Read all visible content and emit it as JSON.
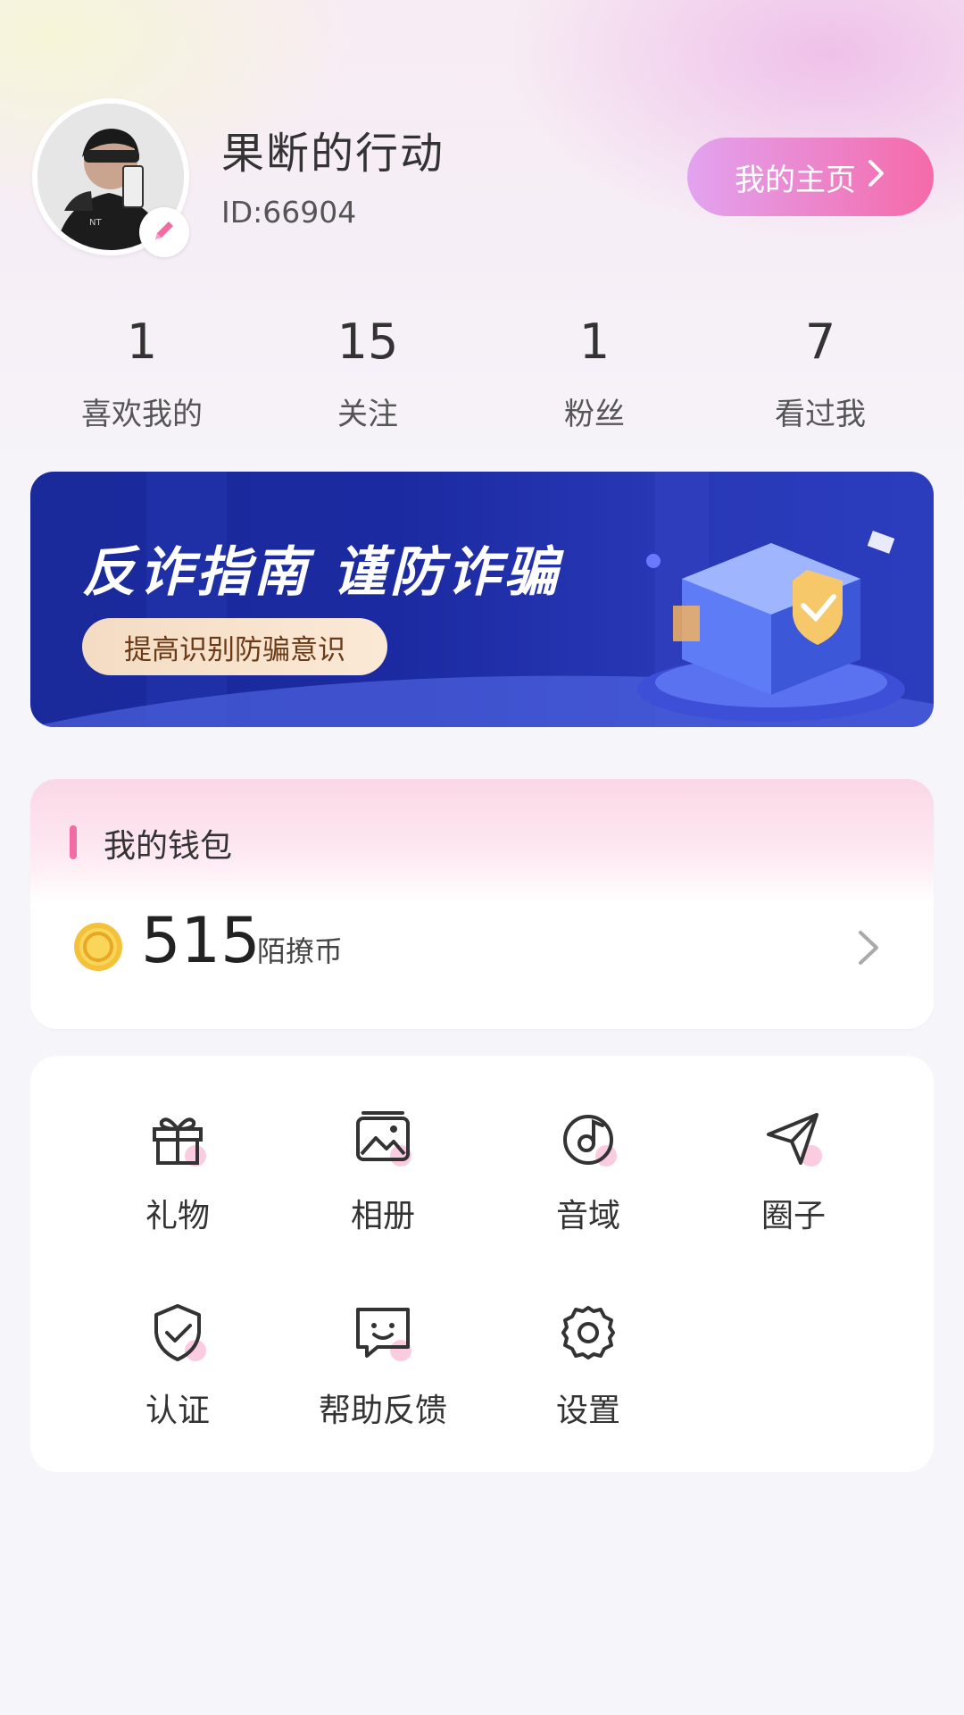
{
  "profile": {
    "username": "果断的行动",
    "user_id": "ID:66904",
    "home_button": "我的主页"
  },
  "stats": [
    {
      "value": "1",
      "label": "喜欢我的"
    },
    {
      "value": "15",
      "label": "关注"
    },
    {
      "value": "1",
      "label": "粉丝"
    },
    {
      "value": "7",
      "label": "看过我"
    }
  ],
  "banner": {
    "title": "反诈指南 谨防诈骗",
    "pill": "提高识别防骗意识"
  },
  "wallet": {
    "title": "我的钱包",
    "amount": "515",
    "unit": "陌撩币"
  },
  "menu": [
    {
      "label": "礼物",
      "icon": "gift-icon"
    },
    {
      "label": "相册",
      "icon": "album-icon"
    },
    {
      "label": "音域",
      "icon": "music-icon"
    },
    {
      "label": "圈子",
      "icon": "send-icon"
    },
    {
      "label": "认证",
      "icon": "shield-icon"
    },
    {
      "label": "帮助反馈",
      "icon": "feedback-icon"
    },
    {
      "label": "设置",
      "icon": "gear-icon"
    }
  ],
  "colors": {
    "accent": "#f56aa9",
    "banner_bg": "#1b2aa0"
  }
}
